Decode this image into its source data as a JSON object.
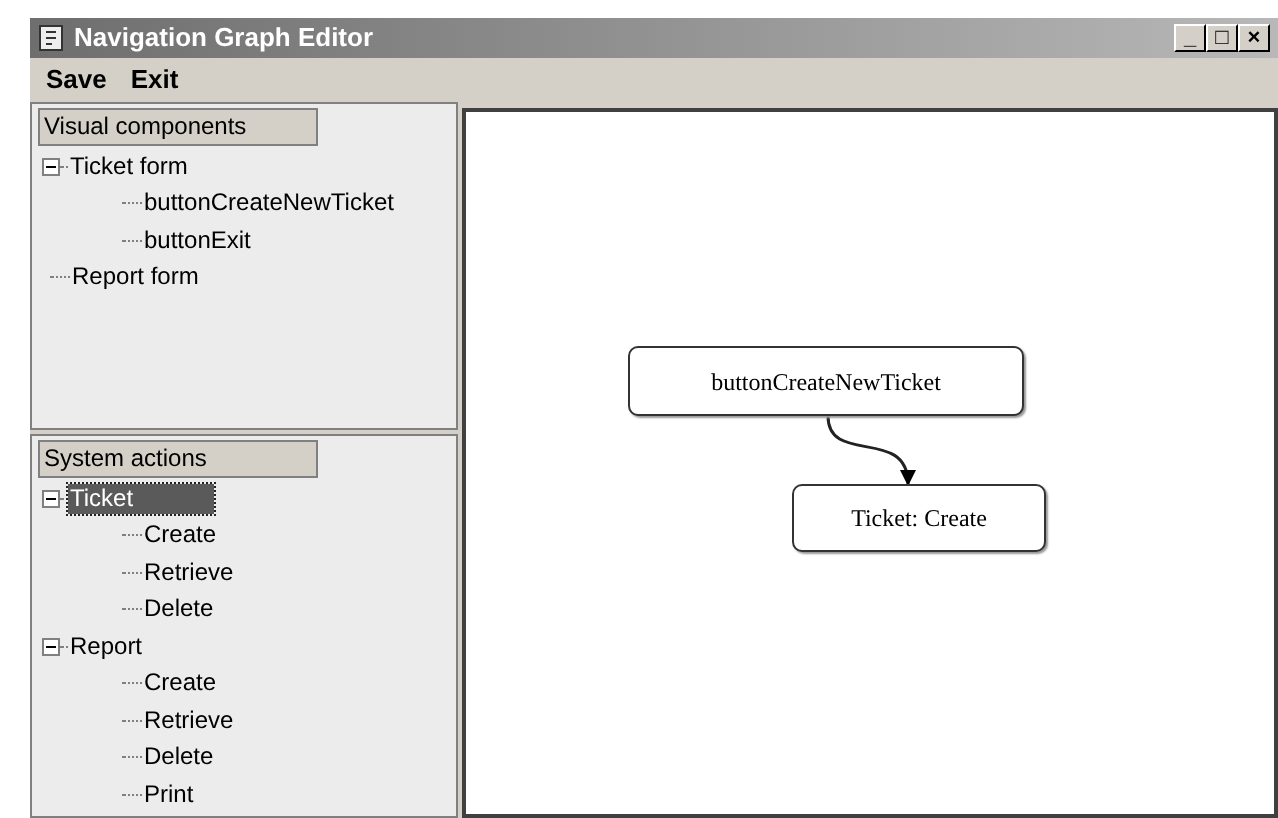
{
  "window": {
    "title": "Navigation Graph Editor",
    "controls": [
      "_",
      "□",
      "×"
    ]
  },
  "menu": [
    "Save",
    "Exit"
  ],
  "panels": [
    {
      "header": "Visual components",
      "tree": [
        {
          "label": "Ticket form",
          "expanded": true,
          "selected": false,
          "children": [
            {
              "label": "buttonCreateNewTicket",
              "selected": false
            },
            {
              "label": "buttonExit",
              "selected": false
            }
          ]
        },
        {
          "label": "Report form",
          "selected": false
        }
      ]
    },
    {
      "header": "System actions",
      "tree": [
        {
          "label": "Ticket",
          "expanded": true,
          "selected": true,
          "children": [
            {
              "label": "Create",
              "selected": false
            },
            {
              "label": "Retrieve",
              "selected": false
            },
            {
              "label": "Delete",
              "selected": false
            }
          ]
        },
        {
          "label": "Report",
          "expanded": true,
          "selected": false,
          "children": [
            {
              "label": "Create",
              "selected": false
            },
            {
              "label": "Retrieve",
              "selected": false
            },
            {
              "label": "Delete",
              "selected": false
            },
            {
              "label": "Print",
              "selected": false
            }
          ]
        }
      ]
    }
  ],
  "graph": {
    "nodes": [
      {
        "label": "buttonCreateNewTicket"
      },
      {
        "label": "Ticket: Create"
      }
    ]
  }
}
